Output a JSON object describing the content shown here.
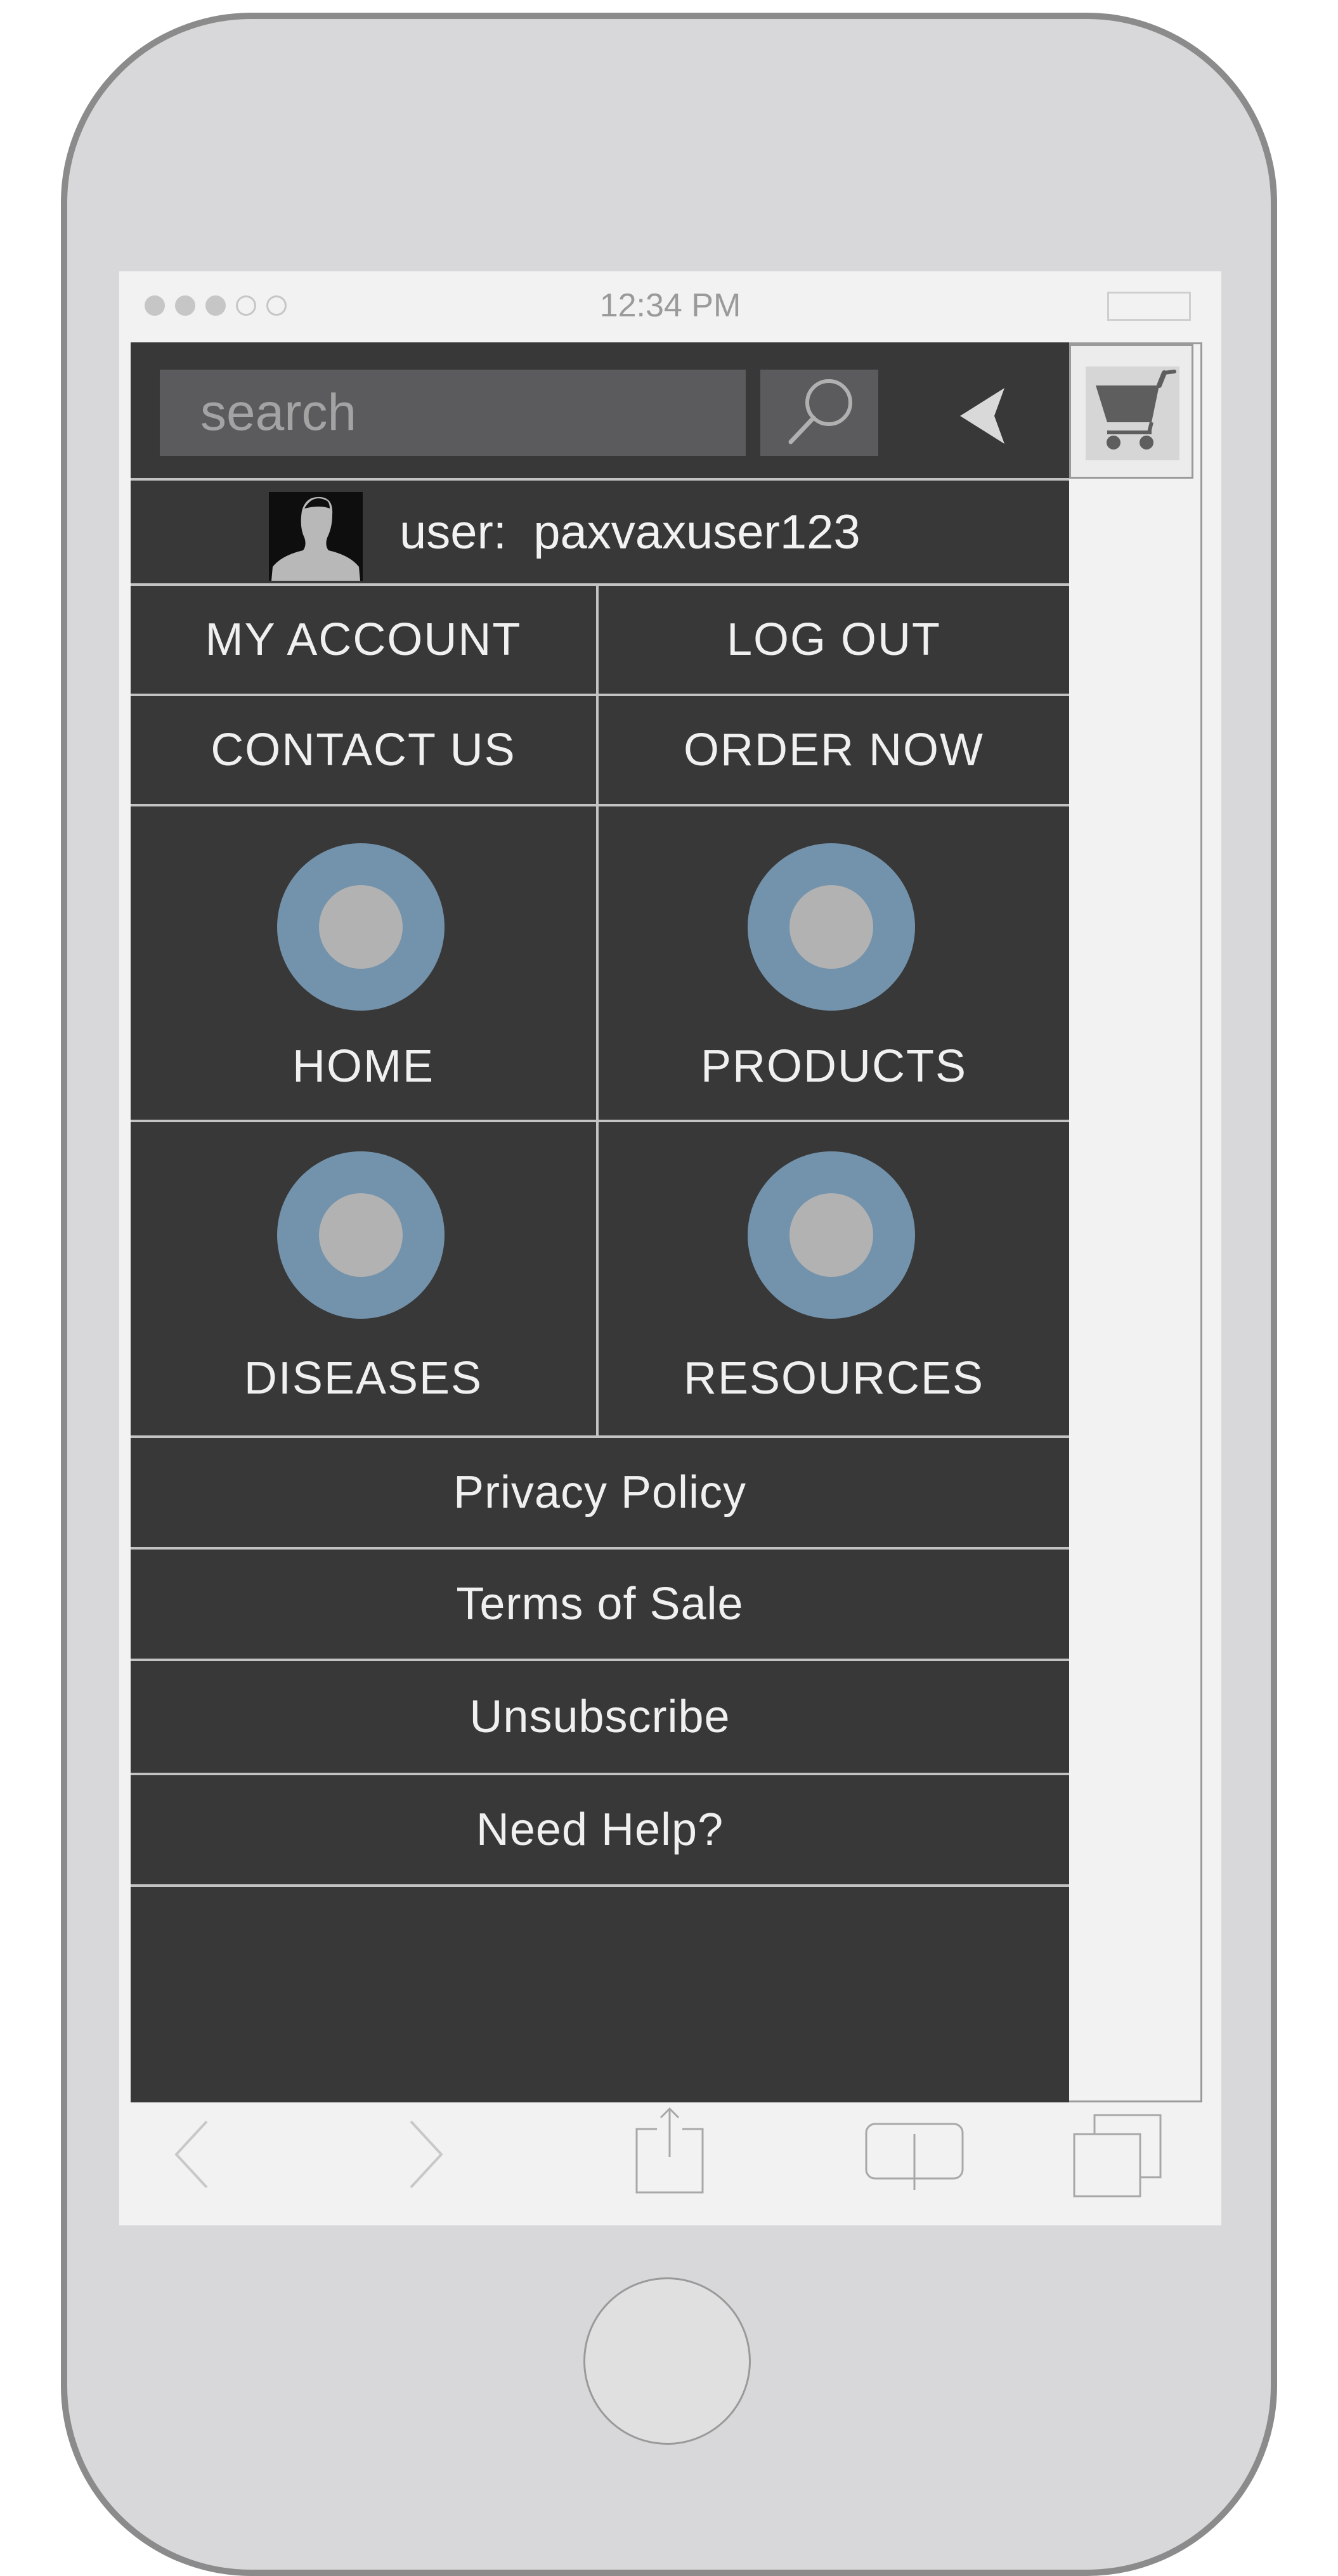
{
  "status_bar": {
    "time": "12:34 PM",
    "signal_dots": [
      true,
      true,
      true,
      false,
      false
    ]
  },
  "header": {
    "search_placeholder": "search",
    "search_icon": "magnifier-icon",
    "back_icon": "chevron-left-icon",
    "cart_icon": "shopping-cart-icon"
  },
  "user": {
    "label": "user:  paxvaxuser123",
    "avatar_icon": "user-silhouette-icon"
  },
  "account_buttons": [
    {
      "label": "MY ACCOUNT"
    },
    {
      "label": "LOG OUT"
    },
    {
      "label": "CONTACT US"
    },
    {
      "label": "ORDER NOW"
    }
  ],
  "nav_tiles": [
    {
      "label": "HOME",
      "icon": "circle-placeholder-icon"
    },
    {
      "label": "PRODUCTS",
      "icon": "circle-placeholder-icon"
    },
    {
      "label": "DISEASES",
      "icon": "circle-placeholder-icon"
    },
    {
      "label": "RESOURCES",
      "icon": "circle-placeholder-icon"
    }
  ],
  "links": [
    {
      "label": "Privacy Policy"
    },
    {
      "label": "Terms of Sale"
    },
    {
      "label": "Unsubscribe"
    },
    {
      "label": "Need Help?"
    }
  ],
  "browser_toolbar": {
    "icons": [
      "back-arrow-icon",
      "forward-arrow-icon",
      "share-icon",
      "bookmarks-icon",
      "tabs-icon"
    ]
  },
  "colors": {
    "menu_background": "#383838",
    "search_background": "#5b5b5d",
    "circle_ring": "#7393ac",
    "circle_center": "#b2b2b2",
    "divider": "#c3c3c3"
  }
}
